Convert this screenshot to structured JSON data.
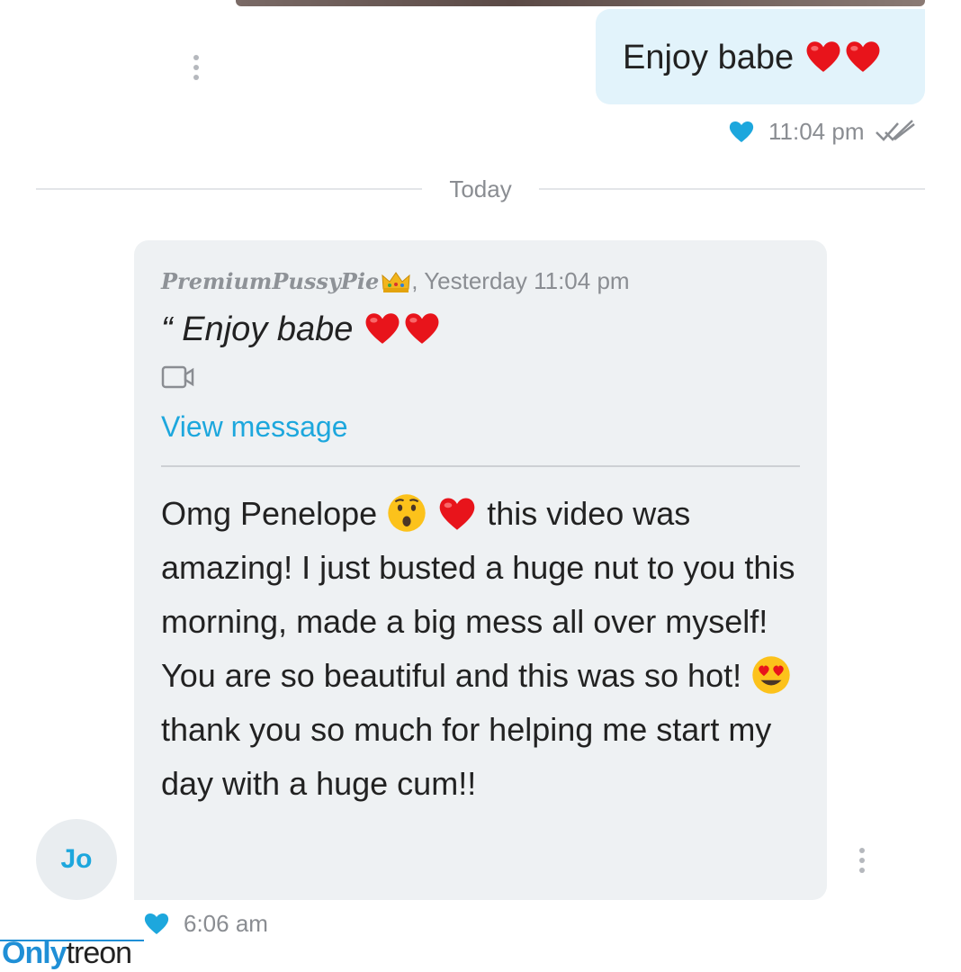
{
  "sent_message": {
    "text": "Enjoy babe",
    "emoji": [
      "red-heart",
      "red-heart"
    ],
    "time": "11:04 pm",
    "liked": true,
    "read_receipt": "double-check-icon"
  },
  "date_divider": {
    "label": "Today"
  },
  "received_message": {
    "quote": {
      "author": "PremiumPussyPie",
      "author_badge": "crown-emoji",
      "timestamp": ", Yesterday 11:04 pm",
      "text": "“ Enjoy babe",
      "attachment": "video-icon",
      "view_link": "View message"
    },
    "body": {
      "part1": "Omg Penelope",
      "part2": "this video was amazing! I just busted a huge nut to you this morning, made a big mess all over myself! You are so beautiful and this was so hot!",
      "part3": "thank you so much for helping me start my day with a huge cum!!"
    },
    "sender_initials": "Jo",
    "time": "6:06 am",
    "liked": true
  },
  "watermark": {
    "part_a": "Only",
    "part_b": "treon"
  },
  "colors": {
    "accent": "#1da7dd",
    "sent_bubble": "#e2f3fb",
    "received_bubble": "#eef1f3",
    "heart_like": "#1da7dd",
    "meta_text": "#8a8d92"
  }
}
